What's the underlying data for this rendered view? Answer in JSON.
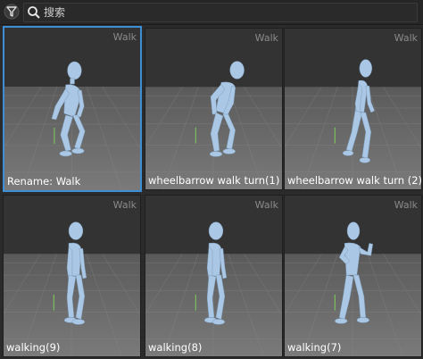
{
  "search": {
    "placeholder": "搜索",
    "value": ""
  },
  "icons": {
    "filter": "filter-icon",
    "search": "search-icon"
  },
  "colors": {
    "selection": "#3c8fd6",
    "figure": "#aac8e6",
    "floor": "#6f6f6f",
    "sky": "#333333"
  },
  "cards": [
    {
      "tag": "Walk",
      "label": "Rename: Walk",
      "selected": true
    },
    {
      "tag": "Walk",
      "label": "wheelbarrow walk turn(1)",
      "selected": false
    },
    {
      "tag": "Walk",
      "label": "wheelbarrow walk turn (2)",
      "selected": false
    },
    {
      "tag": "Walk",
      "label": "walking(9)",
      "selected": false
    },
    {
      "tag": "Walk",
      "label": "walking(8)",
      "selected": false
    },
    {
      "tag": "Walk",
      "label": "walking(7)",
      "selected": false
    }
  ]
}
